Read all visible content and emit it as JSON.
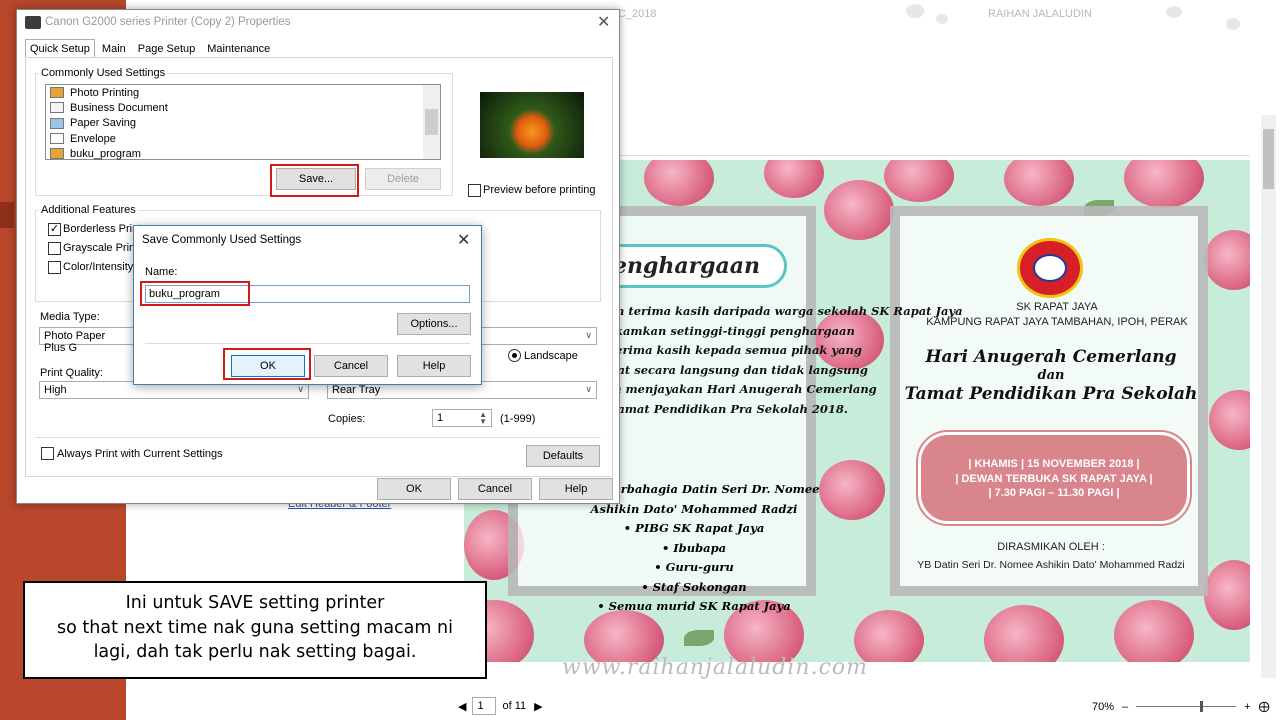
{
  "app_top": {
    "file_tab": "C_2018",
    "author": "RAIHAN JALALUDIN"
  },
  "print_dialog": {
    "title": "Canon G2000 series Printer (Copy 2) Properties",
    "tabs": [
      "Quick Setup",
      "Main",
      "Page Setup",
      "Maintenance"
    ],
    "commonly_used_label": "Commonly Used Settings",
    "settings_list": [
      "Photo Printing",
      "Business Document",
      "Paper Saving",
      "Envelope",
      "buku_program"
    ],
    "save_btn": "Save...",
    "delete_btn": "Delete",
    "preview_label": "Preview before printing",
    "additional_features": "Additional Features",
    "borderless": "Borderless Print",
    "grayscale": "Grayscale Print",
    "color_intensity": "Color/Intensity",
    "media_type_label": "Media Type:",
    "media_type_value": "Photo Paper Plus G",
    "landscape": "Landscape",
    "print_quality_label": "Print Quality:",
    "print_quality_value": "High",
    "paper_source_value": "Rear Tray",
    "copies_label": "Copies:",
    "copies_value": "1",
    "copies_range": "(1-999)",
    "always_print": "Always Print with Current Settings",
    "defaults_btn": "Defaults",
    "ok_btn": "OK",
    "cancel_btn": "Cancel",
    "help_btn": "Help"
  },
  "save_dialog": {
    "title": "Save Commonly Used Settings",
    "name_label": "Name:",
    "name_value": "buku_program",
    "options_btn": "Options...",
    "ok_btn": "OK",
    "cancel_btn": "Cancel",
    "help_btn": "Help"
  },
  "edit_link": "Edit Header & Footer",
  "invite": {
    "banner": "Penghargaan",
    "body_lines": [
      "Jutaan terima kasih daripada warga sekolah SK Rapat Jaya",
      "merakamkan setinggi-tinggi penghargaan",
      "dan terima kasih kepada semua pihak yang",
      "terlibat secara langsung dan tidak langsung",
      "dalam menjayakan Hari Anugerah Cemerlang",
      "dan Tamat Pendidikan Pra Sekolah 2018."
    ],
    "bullets": [
      "Yang Berbahagia Datin Seri Dr. Nomee",
      "Ashikin Dato' Mohammed Radzi",
      "PIBG SK Rapat Jaya",
      "Ibubapa",
      "Guru-guru",
      "Staf Sokongan",
      "Semua murid SK Rapat Jaya"
    ],
    "school_name": "SK RAPAT JAYA",
    "school_address": "KAMPUNG RAPAT JAYA TAMBAHAN, IPOH, PERAK",
    "event_line1": "Hari Anugerah Cemerlang",
    "event_line2": "dan",
    "event_line3": "Tamat Pendidikan Pra Sekolah",
    "detail_line1": "| KHAMIS | 15 NOVEMBER 2018 |",
    "detail_line2": "| DEWAN TERBUKA SK RAPAT JAYA |",
    "detail_line3": "| 7.30 PAGI – 11.30 PAGI |",
    "officiated_by": "DIRASMIKAN OLEH :",
    "officiant": "YB Datin Seri Dr. Nomee Ashikin Dato' Mohammed Radzi"
  },
  "watermark": "www.raihanjalaludin.com",
  "pager": {
    "page": "1",
    "of_label": "of 11"
  },
  "zoom": {
    "level": "70%",
    "minus": "–",
    "plus": "+"
  },
  "note": {
    "line1": "Ini untuk SAVE setting printer",
    "line2": "so that next time nak guna setting macam ni",
    "line3": "lagi, dah tak perlu nak setting bagai."
  }
}
